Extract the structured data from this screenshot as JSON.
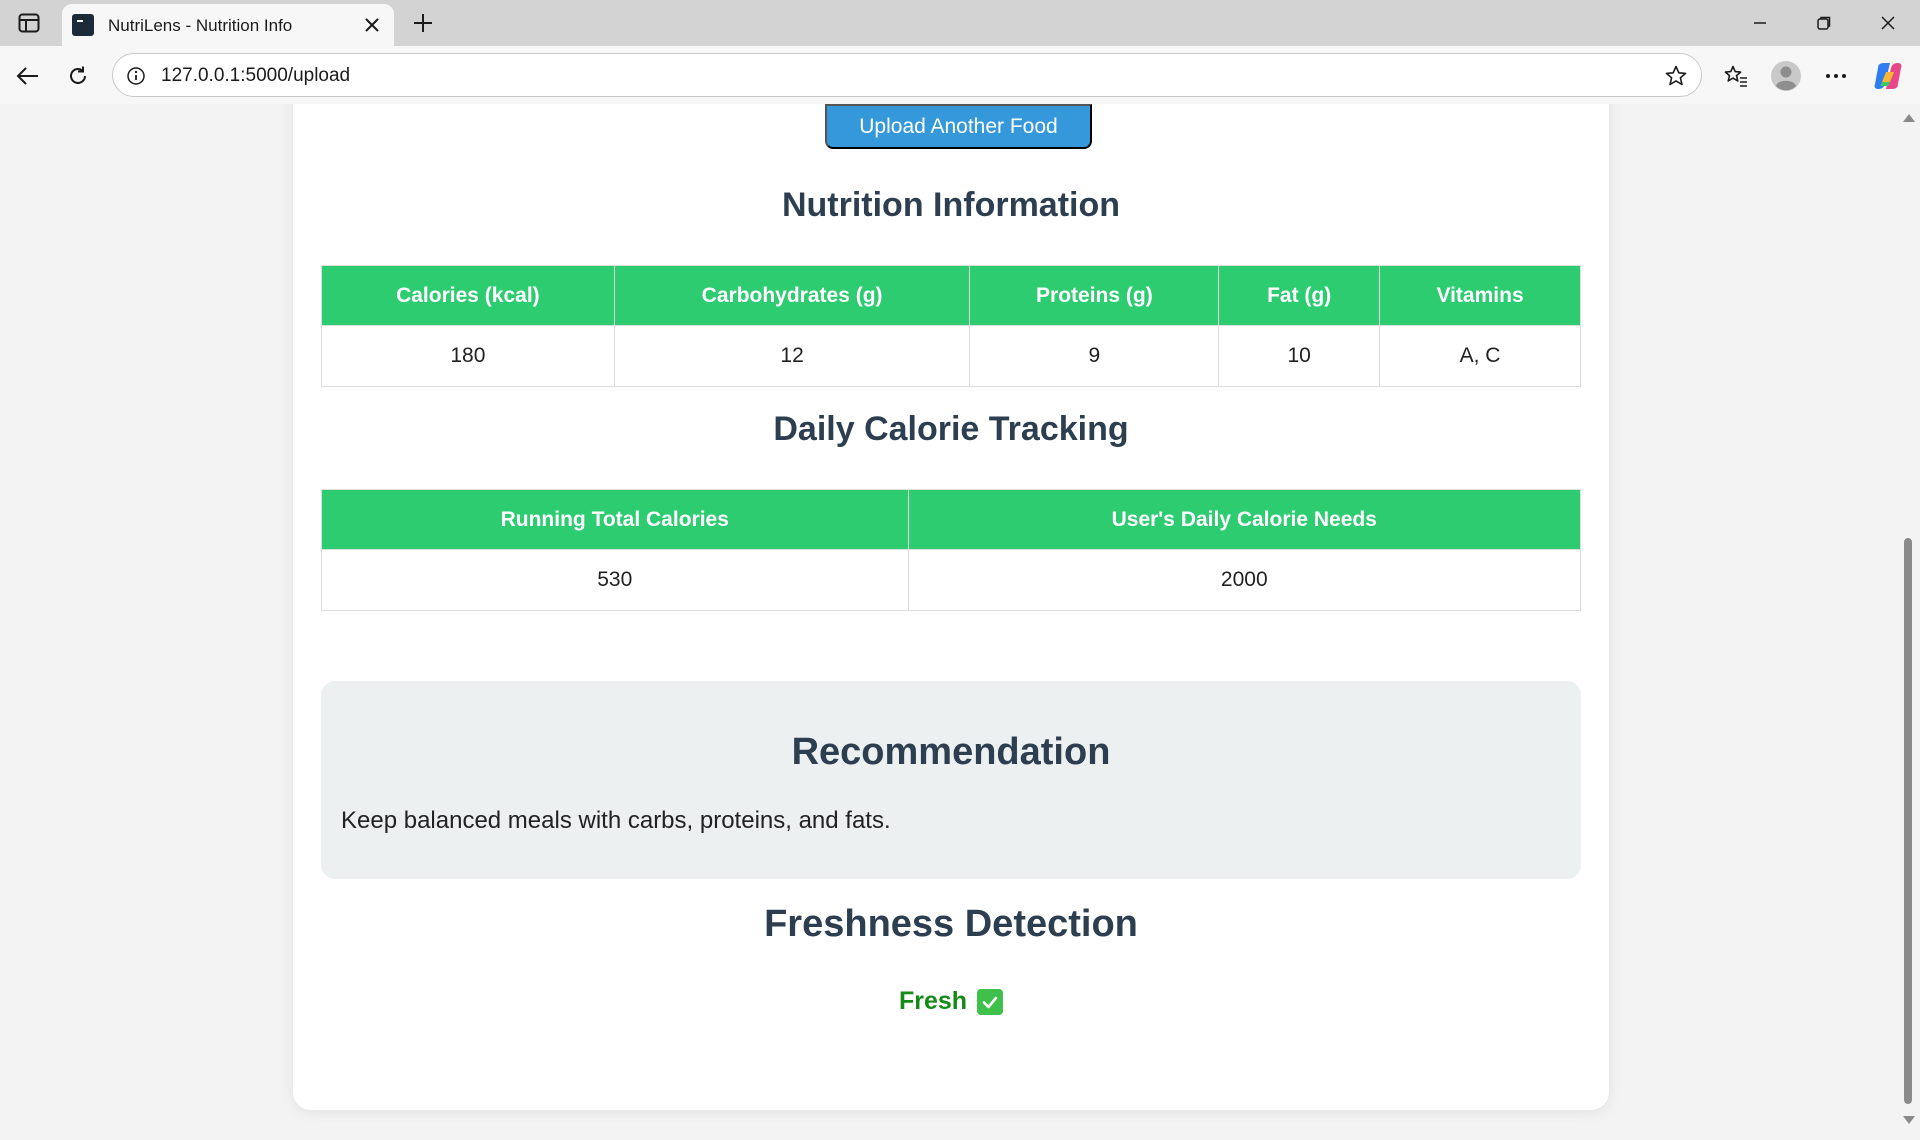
{
  "browser": {
    "tab_title": "NutriLens - Nutrition Info",
    "url": "127.0.0.1:5000/upload"
  },
  "page": {
    "upload_button": "Upload Another Food",
    "nutrition": {
      "heading": "Nutrition Information",
      "columns": [
        "Calories (kcal)",
        "Carbohydrates (g)",
        "Proteins (g)",
        "Fat (g)",
        "Vitamins"
      ],
      "row": [
        "180",
        "12",
        "9",
        "10",
        "A, C"
      ]
    },
    "daily": {
      "heading": "Daily Calorie Tracking",
      "columns": [
        "Running Total Calories",
        "User's Daily Calorie Needs"
      ],
      "row": [
        "530",
        "2000"
      ]
    },
    "recommendation": {
      "heading": "Recommendation",
      "text": "Keep balanced meals with carbs, proteins, and fats."
    },
    "freshness": {
      "heading": "Freshness Detection",
      "status": "Fresh"
    }
  },
  "colors": {
    "table_header": "#2ecc71",
    "button": "#3498db",
    "heading": "#2c3e50",
    "fresh": "#168a16"
  },
  "icons": [
    "sidebar-toggle-icon",
    "terminal-favicon-icon",
    "close-icon",
    "plus-icon",
    "minimize-icon",
    "restore-icon",
    "back-icon",
    "reload-icon",
    "info-icon",
    "star-icon",
    "favorites-icon",
    "profile-icon",
    "more-icon",
    "copilot-icon",
    "checkmark-icon"
  ]
}
